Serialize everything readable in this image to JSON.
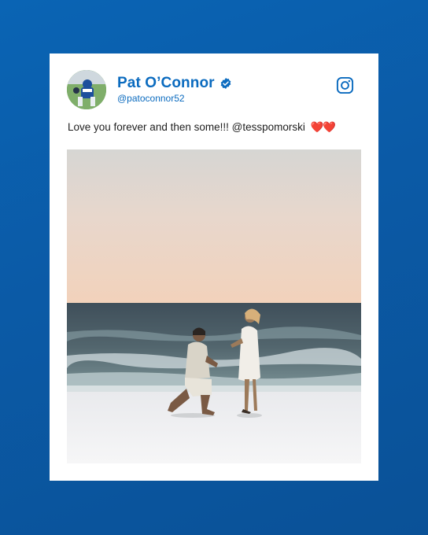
{
  "post": {
    "author_name": "Pat O’Connor",
    "handle": "@patoconnor52",
    "verified_icon": "verified-badge-icon",
    "platform_icon": "instagram-icon",
    "text": "Love you forever and then some!!! @tesspomorski",
    "emoji": "❤️❤️"
  },
  "colors": {
    "background": "#0b5aa6",
    "accent": "#0b6bbf",
    "card": "#ffffff"
  }
}
